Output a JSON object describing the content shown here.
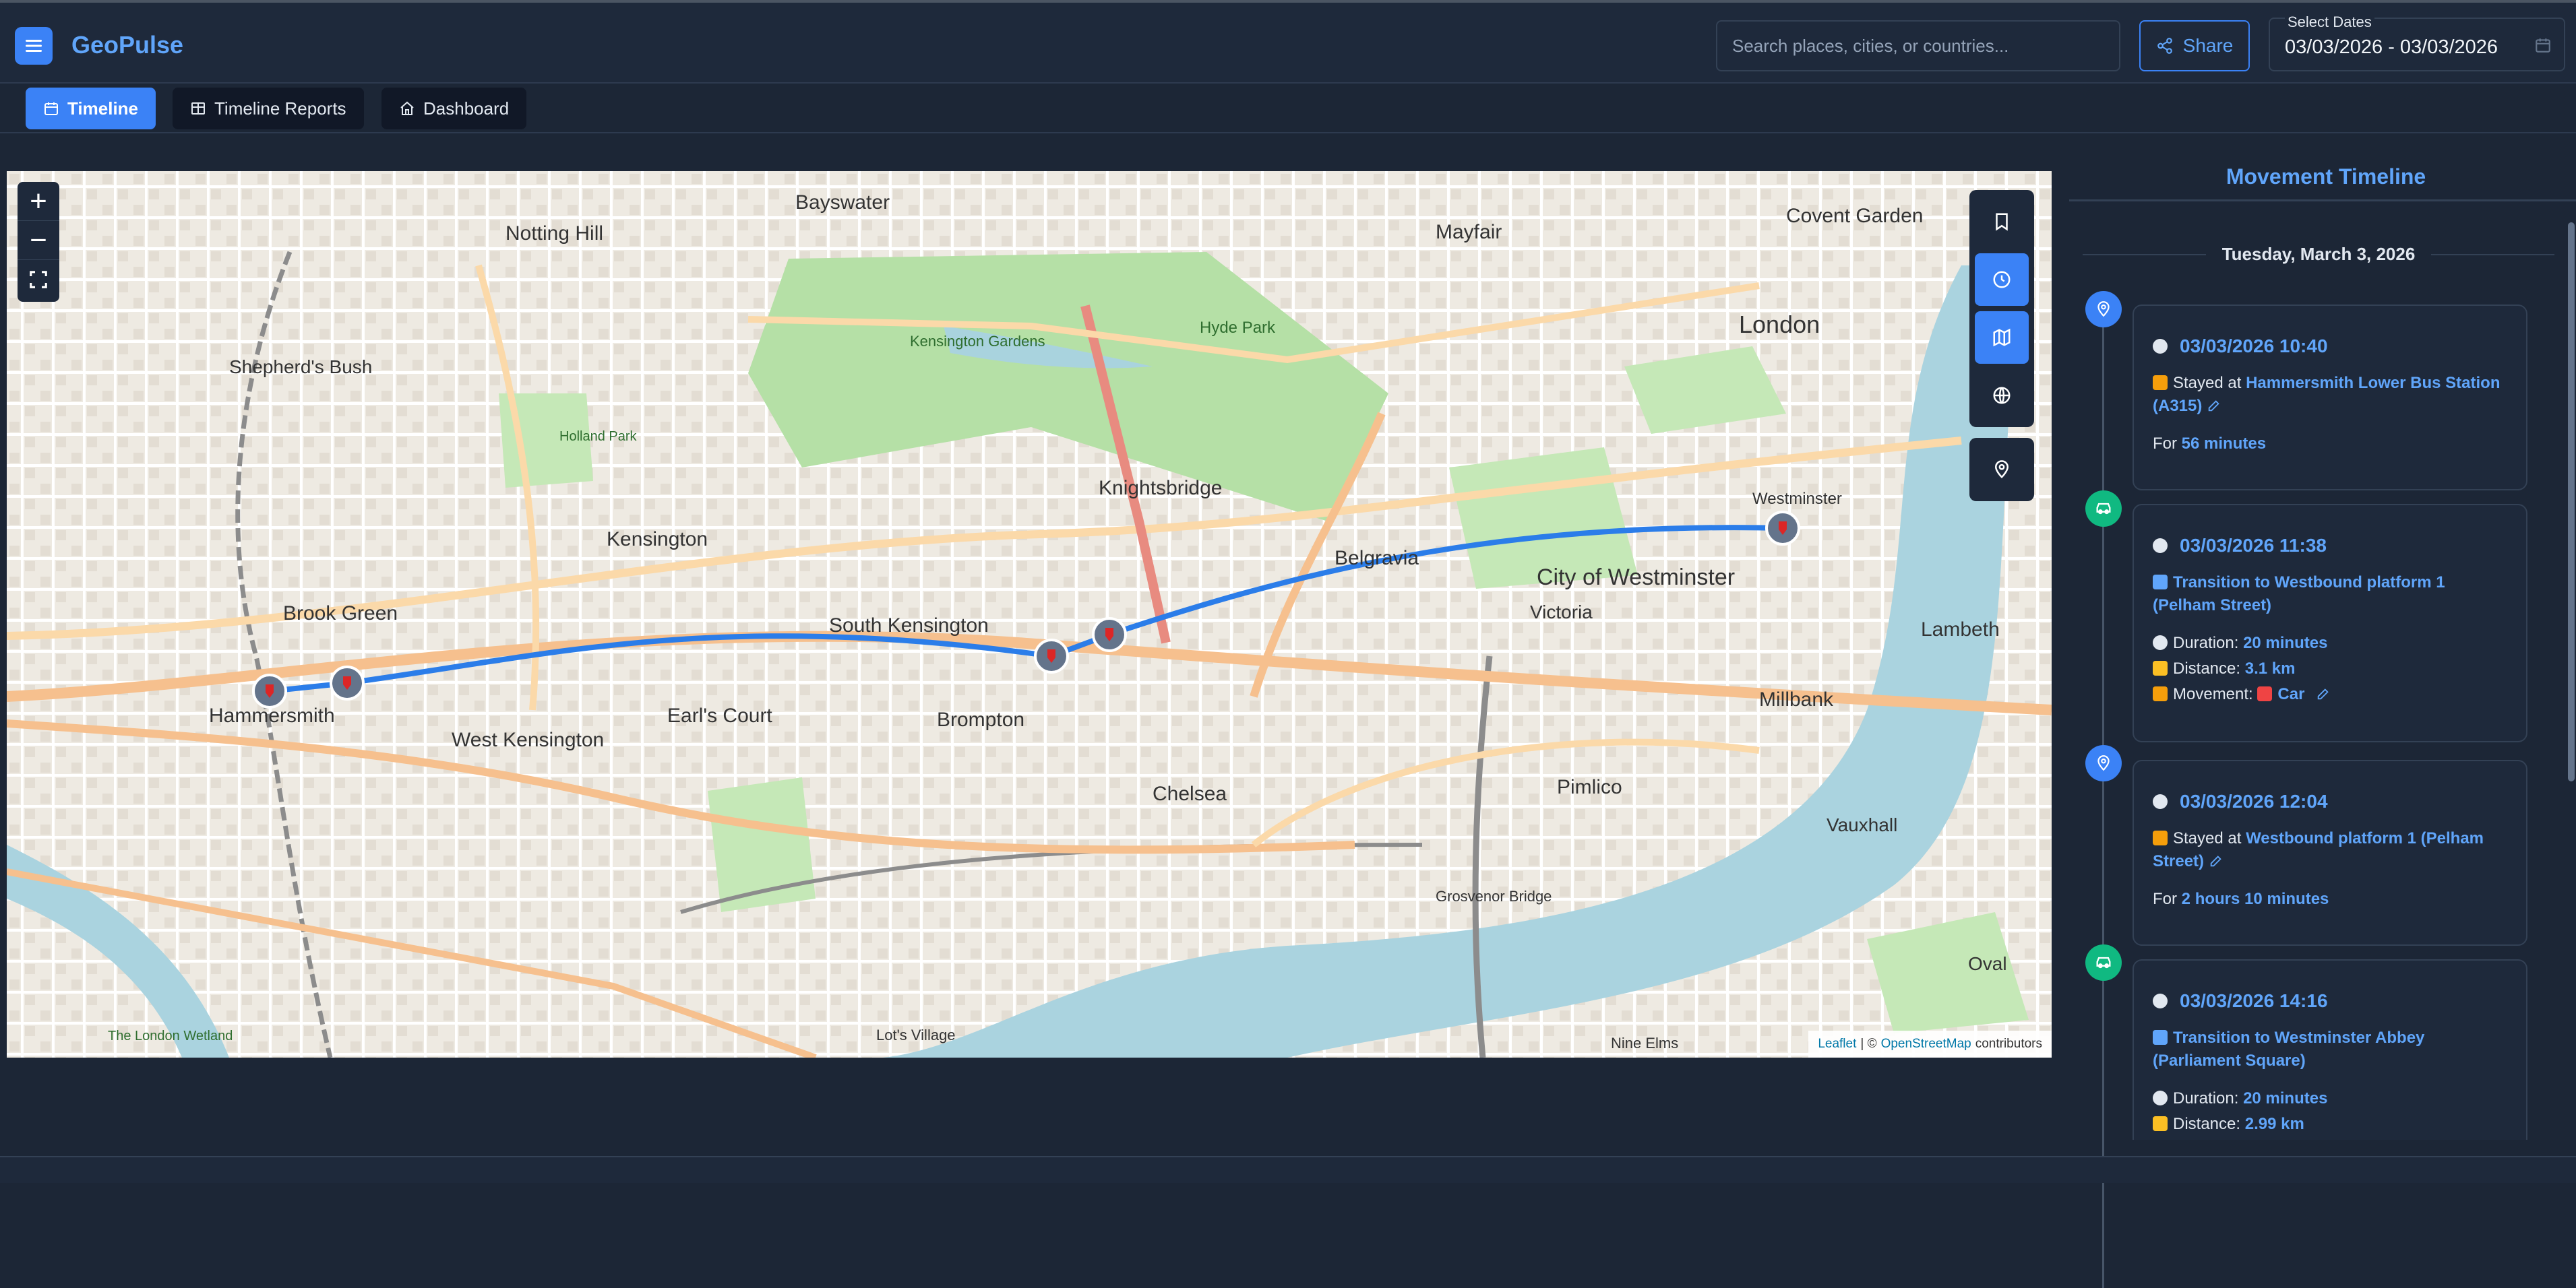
{
  "app": {
    "name": "GeoPulse"
  },
  "header": {
    "search_placeholder": "Search places, cities, or countries...",
    "share_label": "Share",
    "dates_label": "Select Dates",
    "dates_value": "03/03/2026 - 03/03/2026"
  },
  "tabs": [
    {
      "label": "Timeline",
      "active": true,
      "icon": "calendar-icon"
    },
    {
      "label": "Timeline Reports",
      "active": false,
      "icon": "table-icon"
    },
    {
      "label": "Dashboard",
      "active": false,
      "icon": "home-icon"
    }
  ],
  "map": {
    "labels": [
      "Bayswater",
      "Notting Hill",
      "Mayfair",
      "Covent Garden",
      "London",
      "Shepherd's Bush",
      "Kensington Gardens",
      "Hyde Park",
      "Holland Park",
      "Kensington",
      "Knightsbridge",
      "Belgravia",
      "City of Westminster",
      "Westminster",
      "Brook Green",
      "South Kensington",
      "Victoria",
      "Lambeth",
      "Hammersmith",
      "Earl's Court",
      "West Kensington",
      "Brompton",
      "Chelsea",
      "Millbank",
      "Pimlico",
      "Vauxhall",
      "Grosvenor Bridge",
      "Nine Elms",
      "Oval",
      "The London Wetland",
      "Lot's Village"
    ],
    "route_color": "#2b7de9",
    "attribution": {
      "leaflet": "Leaflet",
      "separator": "| ©",
      "osm": "OpenStreetMap",
      "suffix": "contributors"
    }
  },
  "timeline": {
    "title": "Movement Timeline",
    "date_header": "Tuesday, March 3, 2026",
    "items": [
      {
        "type": "stay",
        "time": "03/03/2026 10:40",
        "prefix": "Stayed at",
        "place": "Hammersmith Lower Bus Station (A315)",
        "for_label": "For",
        "for_value": "56 minutes"
      },
      {
        "type": "trip",
        "time": "03/03/2026 11:38",
        "prefix": "Transition to",
        "place": "Westbound platform 1 (Pelham Street)",
        "duration_label": "Duration:",
        "duration_value": "20 minutes",
        "distance_label": "Distance:",
        "distance_value": "3.1 km",
        "movement_label": "Movement:",
        "movement_value": "Car"
      },
      {
        "type": "stay",
        "time": "03/03/2026 12:04",
        "prefix": "Stayed at",
        "place": "Westbound platform 1 (Pelham Street)",
        "for_label": "For",
        "for_value": "2 hours 10 minutes"
      },
      {
        "type": "trip",
        "time": "03/03/2026 14:16",
        "prefix": "Transition to",
        "place": "Westminster Abbey (Parliament Square)",
        "duration_label": "Duration:",
        "duration_value": "20 minutes",
        "distance_label": "Distance:",
        "distance_value": "2.99 km"
      }
    ]
  },
  "colors": {
    "accent": "#3b82f6",
    "stay_marker": "#3b82f6",
    "trip_marker": "#10b981",
    "background": "#1c2636"
  }
}
